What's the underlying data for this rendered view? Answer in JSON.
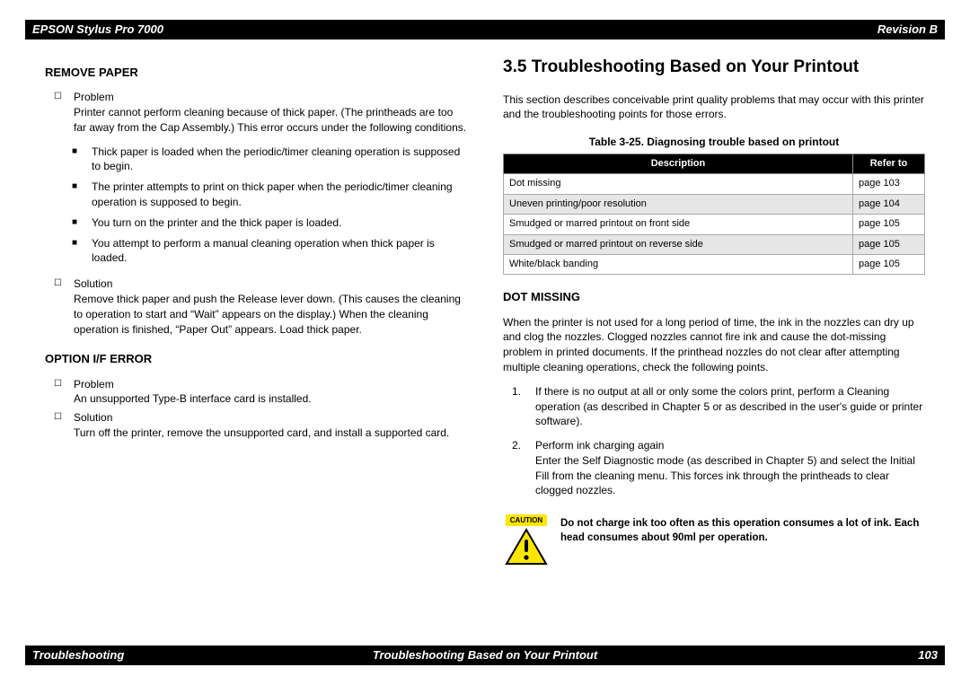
{
  "header": {
    "left": "EPSON Stylus Pro 7000",
    "right": "Revision B"
  },
  "footer": {
    "left": "Troubleshooting",
    "center": "Troubleshooting Based on Your Printout",
    "right": "103"
  },
  "left": {
    "remove_paper": {
      "title": "REMOVE PAPER",
      "problem_label": "Problem",
      "problem_text": "Printer cannot perform cleaning because of thick paper. (The printheads are too far away from the Cap Assembly.) This error occurs under the following conditions.",
      "bullets": [
        "Thick paper is loaded when the periodic/timer cleaning operation is supposed to begin.",
        "The printer attempts to print on thick paper when the periodic/timer cleaning operation is supposed to begin.",
        "You turn on the printer and the thick paper is loaded.",
        "You attempt to perform a manual cleaning operation when thick paper is loaded."
      ],
      "solution_label": "Solution",
      "solution_text": "Remove thick paper and push the Release lever down. (This causes the cleaning to operation to start and “Wait” appears on the display.) When the cleaning operation is finished, “Paper Out” appears. Load thick paper."
    },
    "option_if": {
      "title": "OPTION I/F ERROR",
      "problem_label": "Problem",
      "problem_text": "An unsupported Type-B interface card is installed.",
      "solution_label": "Solution",
      "solution_text": "Turn off the printer, remove the unsupported card, and install a supported card."
    }
  },
  "right": {
    "main_title": "3.5  Troubleshooting Based on Your Printout",
    "intro": "This section describes conceivable print quality problems that may occur with this printer and the troubleshooting points for those errors.",
    "table_caption": "Table 3-25.  Diagnosing trouble based on printout",
    "table_headers": {
      "desc": "Description",
      "ref": "Refer to"
    },
    "table_rows": [
      {
        "desc": "Dot missing",
        "ref": "page 103"
      },
      {
        "desc": "Uneven printing/poor resolution",
        "ref": "page 104"
      },
      {
        "desc": "Smudged or marred printout on front side",
        "ref": "page 105"
      },
      {
        "desc": "Smudged or marred printout on reverse side",
        "ref": "page 105"
      },
      {
        "desc": "White/black banding",
        "ref": "page 105"
      }
    ],
    "dot_missing": {
      "title": "DOT MISSING",
      "text": "When the printer is not used for a long period of time, the ink in the nozzles can dry up and clog the nozzles. Clogged nozzles cannot fire ink and cause the dot-missing problem in printed documents. If the printhead nozzles do not clear after attempting multiple cleaning operations, check the following points.",
      "steps": [
        {
          "n": "1.",
          "lead": "If there is no output at all or only some the colors print, perform a Cleaning operation (as described in Chapter 5 or as described in the user's guide or printer software)."
        },
        {
          "n": "2.",
          "lead": "Perform ink charging again",
          "body": "Enter the Self Diagnostic mode (as described in Chapter 5) and select the Initial Fill from the cleaning menu. This forces ink through the printheads to clear clogged nozzles."
        }
      ]
    },
    "caution": {
      "label": "CAUTION",
      "text": "Do not charge ink too often as this operation consumes a lot of ink. Each head consumes about 90ml per operation."
    }
  }
}
